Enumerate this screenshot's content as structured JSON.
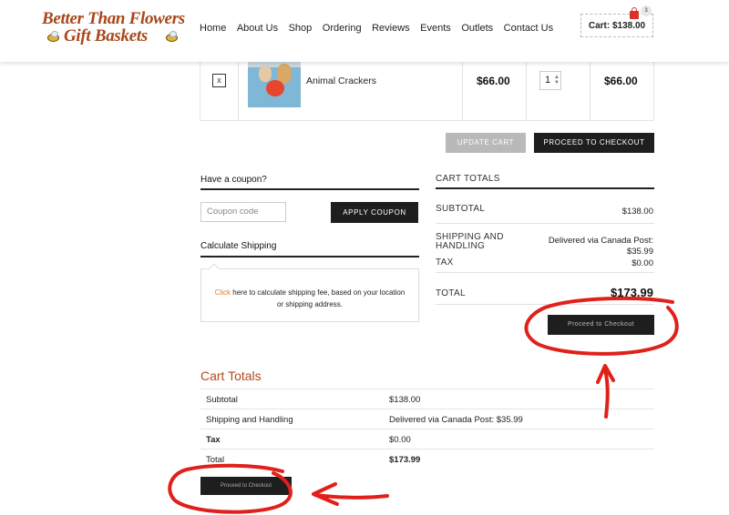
{
  "brand": {
    "line1": "Better Than Flowers",
    "line2": "Gift Baskets"
  },
  "nav": [
    "Home",
    "About Us",
    "Shop",
    "Ordering",
    "Reviews",
    "Events",
    "Outlets",
    "Contact Us"
  ],
  "cart": {
    "summary": "Cart: $138.00",
    "count": "3"
  },
  "cart_item": {
    "remove": "x",
    "name": "Animal Crackers",
    "price": "$66.00",
    "quantity": "1",
    "subtotal": "$66.00"
  },
  "actions": {
    "update_cart": "Update Cart",
    "proceed_top": "Proceed to Checkout"
  },
  "coupon": {
    "title": "Have a coupon?",
    "placeholder": "Coupon code",
    "apply": "Apply Coupon"
  },
  "shipping_calc": {
    "title": "Calculate Shipping",
    "link": "Click",
    "text_line1": " here to calculate shipping fee, based on your location",
    "text_line2": "or shipping address."
  },
  "cart_totals": {
    "title": "Cart Totals",
    "subtotal_label": "Subtotal",
    "subtotal_value": "$138.00",
    "shipping_label_1": "Shipping and",
    "shipping_label_2": "Handling",
    "shipping_value_1": "Delivered via Canada Post:",
    "shipping_value_2": "$35.99",
    "tax_label": "Tax",
    "tax_value": "$0.00",
    "total_label": "Total",
    "total_value": "$173.99",
    "proceed": "Proceed to Checkout"
  },
  "lower_totals": {
    "title": "Cart Totals",
    "rows": [
      {
        "label": "Subtotal",
        "value": "$138.00"
      },
      {
        "label": "Shipping and Handling",
        "value": "Delivered via Canada Post: $35.99"
      },
      {
        "label": "Tax",
        "value": "$0.00"
      },
      {
        "label": "Total",
        "value": "$173.99"
      }
    ],
    "proceed": "Proceed to Checkout"
  },
  "colors": {
    "brand": "#a8471a",
    "accent_orange": "#e07a2e",
    "button_dark": "#1e1e1e",
    "button_disabled": "#b9b9b9",
    "annotation_red": "#e0201a"
  }
}
